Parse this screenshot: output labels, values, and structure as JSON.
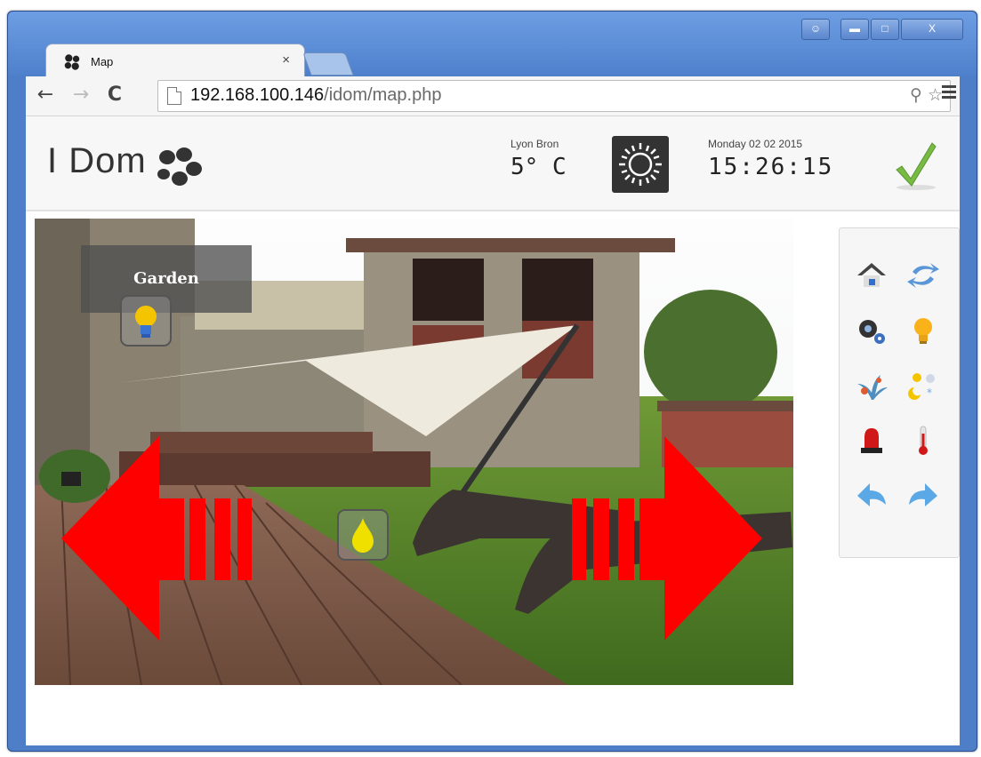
{
  "browser": {
    "tab_title": "Map",
    "tab_close": "×",
    "url_host": "192.168.100.146",
    "url_path": "/idom/map.php"
  },
  "app": {
    "logo_text": "I Dom",
    "weather": {
      "city": "Lyon Bron",
      "temperature": "5° C",
      "icon": "sun-icon"
    },
    "date": "Monday 02 02 2015",
    "time": "15:26:15",
    "status_icon": "checkmark-icon",
    "room": {
      "label": "Garden"
    },
    "devices": [
      {
        "type": "light",
        "icon": "lightbulb-icon"
      },
      {
        "type": "water",
        "icon": "water-drop-icon"
      }
    ],
    "sidebar": [
      "home-icon",
      "sync-icon",
      "gears-icon",
      "lightbulb-icon",
      "plant-icon",
      "weather-icon",
      "alarm-siren-icon",
      "thermometer-icon",
      "back-arrow-icon",
      "forward-arrow-icon"
    ],
    "colors": {
      "nav_arrows": "#ff0000",
      "bulb": "#f5c400",
      "drop": "#f0e000",
      "accent_green": "#77bb44"
    }
  }
}
